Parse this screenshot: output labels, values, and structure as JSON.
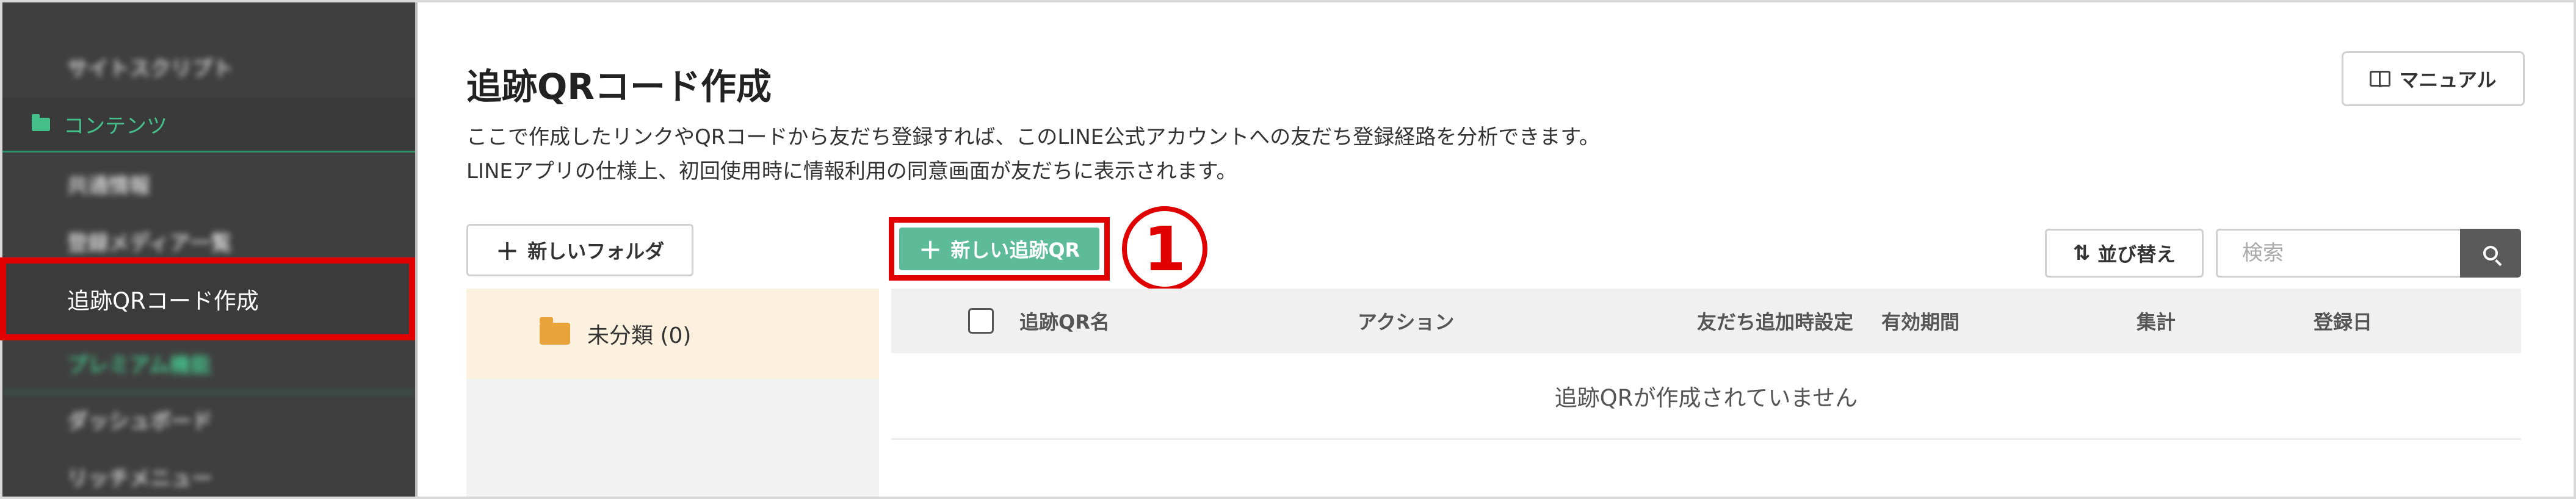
{
  "sidebar": {
    "items_above": [
      "サイトスクリプト"
    ],
    "section": "コンテンツ",
    "items": [
      "共通情報",
      "登録メディア一覧"
    ],
    "active": "追跡QRコード作成",
    "premium": "プレミアム機能",
    "items_below": [
      "ダッシュボード",
      "リッチメニュー"
    ]
  },
  "header": {
    "title": "追跡QRコード作成",
    "desc1": "ここで作成したリンクやQRコードから友だち登録すれば、このLINE公式アカウントへの友だち登録経路を分析できます。",
    "desc2": "LINEアプリの仕様上、初回使用時に情報利用の同意画面が友だちに表示されます。",
    "manual_label": "マニュアル"
  },
  "toolbar": {
    "new_folder_label": "新しいフォルダ",
    "new_qr_label": "新しい追跡QR",
    "marker": "1",
    "sort_label": "並び替え",
    "search_placeholder": "検索"
  },
  "folders": [
    {
      "label": "未分類 (0)"
    }
  ],
  "table": {
    "columns": [
      "追跡QR名",
      "アクション",
      "友だち追加時設定",
      "有効期間",
      "集計",
      "登録日"
    ],
    "empty_message": "追跡QRが作成されていません"
  },
  "colors": {
    "sidebar_bg": "#3f3f3f",
    "accent_green": "#5dbb99",
    "highlight_red": "#e00000",
    "folder_row_bg": "#fcf1df"
  }
}
